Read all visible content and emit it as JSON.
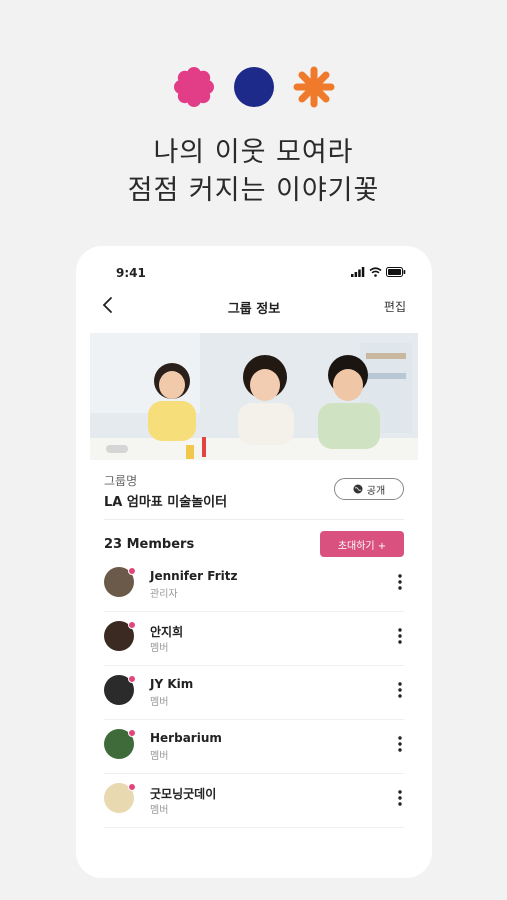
{
  "headline": {
    "line1": "나의 이웃 모여라",
    "line2": "점점 커지는 이야기꽃"
  },
  "brand_colors": [
    "#e23d87",
    "#1d2a8a",
    "#f07a2c"
  ],
  "status_bar": {
    "time": "9:41"
  },
  "nav": {
    "title": "그룹 정보",
    "edit_label": "편집"
  },
  "group": {
    "label": "그룹명",
    "name": "LA 엄마표 미술놀이터",
    "visibility": "공개"
  },
  "members_section": {
    "count_label": "23 Members",
    "invite_label": "초대하기 +"
  },
  "members": [
    {
      "name": "Jennifer Fritz",
      "role": "관리자",
      "avatar_color": "#6b5a4a"
    },
    {
      "name": "안지희",
      "role": "멤버",
      "avatar_color": "#3b2a22"
    },
    {
      "name": "JY Kim",
      "role": "멤버",
      "avatar_color": "#2b2b2b"
    },
    {
      "name": "Herbarium",
      "role": "멤버",
      "avatar_color": "#3f6b3a"
    },
    {
      "name": "굿모닝굿데이",
      "role": "멤버",
      "avatar_color": "#e8d9b0"
    }
  ],
  "accent_color": "#d9527f"
}
